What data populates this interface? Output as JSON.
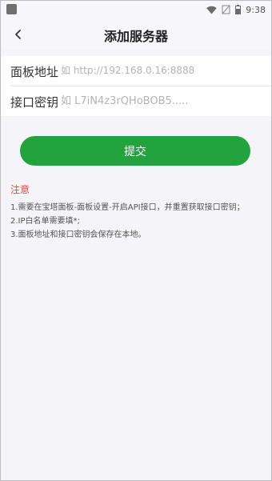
{
  "status_bar": {
    "time": "9:38",
    "icons": [
      "wifi-icon",
      "no-signal-icon",
      "battery-icon"
    ]
  },
  "header": {
    "title": "添加服务器",
    "back_icon": "chevron-left-icon"
  },
  "form": {
    "panel_address": {
      "label": "面板地址",
      "value": "",
      "placeholder": "如 http://192.168.0.16:8888"
    },
    "api_key": {
      "label": "接口密钥",
      "value": "",
      "placeholder": "如 L7iN4z3rQHoBOB5....."
    }
  },
  "submit_label": "提交",
  "notice": {
    "title": "注意",
    "items": [
      "1.需要在宝塔面板-面板设置-开启API接口，并重置获取接口密钥；",
      "2.IP白名单需要填*;",
      "3.面板地址和接口密钥会保存在本地。"
    ]
  },
  "colors": {
    "accent": "#22a33e",
    "notice_title": "#e24a3c",
    "background": "#f4f4f9"
  }
}
